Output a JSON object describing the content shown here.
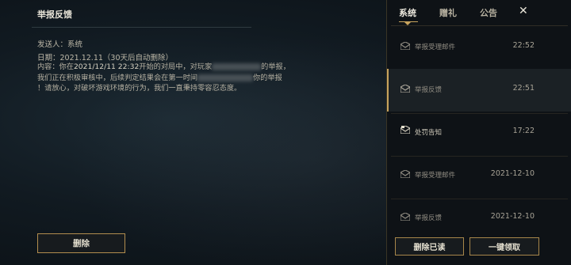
{
  "detail": {
    "title": "举报反馈",
    "sender_label": "发送人：",
    "sender": "系统",
    "date_label": "日期：",
    "date": "2021.12.11（30天后自动删除）",
    "content_line1_a": "内容：你在",
    "content_line1_hl": "2021/12/11 22:32",
    "content_line1_b": "开始的对局中，对玩家",
    "content_line1_c": "的举报，",
    "content_line2_a": "我们正在积极审核中，后续判定结果会在第一时间",
    "content_line2_b": "你的举报",
    "content_line3": "！请放心，对破坏游戏环境的行为，我们一直秉持零容忍态度。",
    "delete_button": "删除"
  },
  "tabs": [
    {
      "label": "系统",
      "active": true
    },
    {
      "label": "赠礼",
      "active": false
    },
    {
      "label": "公告",
      "active": false
    }
  ],
  "close_icon": "close-icon",
  "mails": [
    {
      "title": "举报受理邮件",
      "time": "22:52",
      "selected": false,
      "icon": "read-mail-icon"
    },
    {
      "title": "举报反馈",
      "time": "22:51",
      "selected": true,
      "icon": "read-mail-icon"
    },
    {
      "title": "处罚告知",
      "time": "17:22",
      "selected": false,
      "icon": "penalty-mail-icon"
    },
    {
      "title": "举报受理邮件",
      "time": "2021-12-10",
      "selected": false,
      "icon": "read-mail-icon"
    },
    {
      "title": "举报反馈",
      "time": "2021-12-10",
      "selected": false,
      "icon": "read-mail-icon"
    }
  ],
  "footer": {
    "delete_read": "删除已读",
    "claim_all": "一键领取"
  },
  "colors": {
    "accent_gold": "#c7a35d",
    "button_border": "#b28d4e",
    "background": "#0c1217"
  }
}
